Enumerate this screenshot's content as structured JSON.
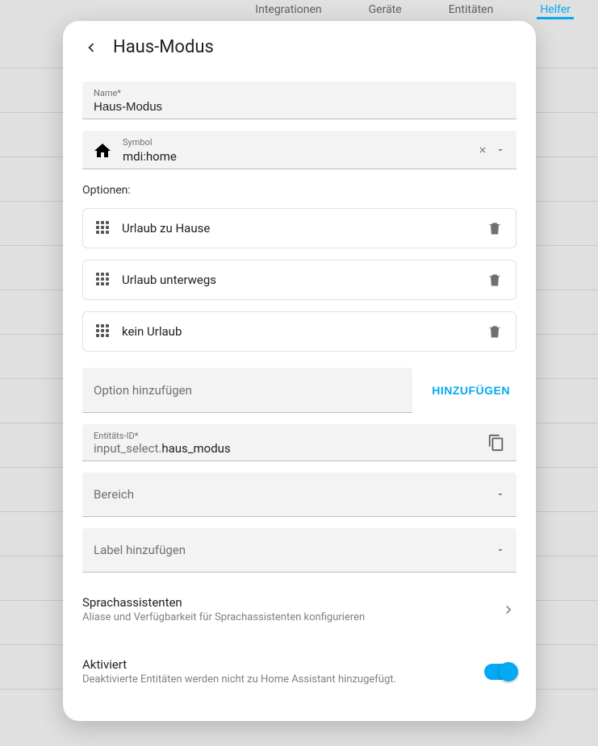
{
  "bg_tabs": {
    "integrations": "Integrationen",
    "devices": "Geräte",
    "entities": "Entitäten",
    "helpers": "Helfer"
  },
  "dialog": {
    "title": "Haus-Modus",
    "name_label": "Name*",
    "name_value": "Haus-Modus",
    "symbol_label": "Symbol",
    "symbol_value": "mdi:home",
    "options_label": "Optionen:",
    "options": [
      {
        "label": "Urlaub zu Hause"
      },
      {
        "label": "Urlaub unterwegs"
      },
      {
        "label": "kein Urlaub"
      }
    ],
    "add_option_placeholder": "Option hinzufügen",
    "add_option_button": "HINZUFÜGEN",
    "entity_id_label": "Entitäts-ID*",
    "entity_id_domain": "input_select.",
    "entity_id_object": "haus_modus",
    "area_placeholder": "Bereich",
    "label_placeholder": "Label hinzufügen",
    "voice": {
      "title": "Sprachassistenten",
      "sub": "Aliase und Verfügbarkeit für Sprachassistenten konfigurieren"
    },
    "enabled": {
      "title": "Aktiviert",
      "sub": "Deaktivierte Entitäten werden nicht zu Home Assistant hinzugefügt.",
      "value": true
    }
  }
}
